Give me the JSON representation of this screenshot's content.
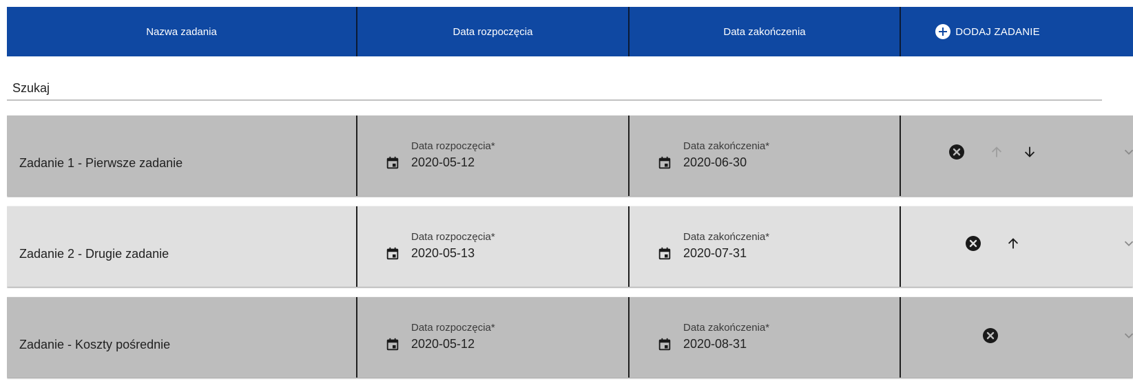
{
  "header": {
    "col_name": "Nazwa zadania",
    "col_start": "Data rozpoczęcia",
    "col_end": "Data zakończenia",
    "add_button": "DODAJ ZADANIE"
  },
  "search": {
    "placeholder": "Szukaj",
    "value": ""
  },
  "tasks": [
    {
      "name": "Zadanie 1 - Pierwsze zadanie",
      "start_label": "Data rozpoczęcia*",
      "start_value": "2020-05-12",
      "end_label": "Data zakończenia*",
      "end_value": "2020-06-30",
      "actions": [
        "remove-icon",
        "arrow-up-icon (disabled)",
        "arrow-down-icon"
      ]
    },
    {
      "name": "Zadanie 2 - Drugie zadanie",
      "start_label": "Data rozpoczęcia*",
      "start_value": "2020-05-13",
      "end_label": "Data zakończenia*",
      "end_value": "2020-07-31",
      "actions": [
        "remove-icon",
        "arrow-up-icon"
      ]
    },
    {
      "name": "Zadanie - Koszty pośrednie",
      "start_label": "Data rozpoczęcia*",
      "start_value": "2020-05-12",
      "end_label": "Data zakończenia*",
      "end_value": "2020-08-31",
      "actions": [
        "remove-icon"
      ]
    }
  ],
  "colors": {
    "header_bg": "#0f48a2",
    "row_dark": "#bdbdbd",
    "row_light": "#e0e0e0",
    "icon_active": "#1a1a1a",
    "icon_disabled": "#9e9e9e"
  }
}
